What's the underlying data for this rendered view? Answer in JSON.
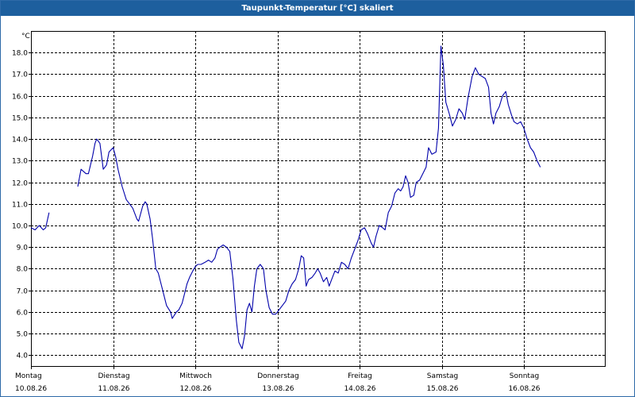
{
  "window": {
    "title": "Taupunkt-Temperatur [°C] skaliert"
  },
  "chart_data": {
    "type": "line",
    "title": "Taupunkt-Temperatur [°C] skaliert",
    "ylabel": "°C",
    "xlabel": "",
    "ylim": [
      3.5,
      19.0
    ],
    "yticks": [
      4.0,
      5.0,
      6.0,
      7.0,
      8.0,
      9.0,
      10.0,
      11.0,
      12.0,
      13.0,
      14.0,
      15.0,
      16.0,
      17.0,
      18.0
    ],
    "xlim": [
      0,
      7
    ],
    "xticks": [
      {
        "x": 0,
        "day": "Montag",
        "date": "10.08.26"
      },
      {
        "x": 1,
        "day": "Dienstag",
        "date": "11.08.26"
      },
      {
        "x": 2,
        "day": "Mittwoch",
        "date": "12.08.26"
      },
      {
        "x": 3,
        "day": "Donnerstag",
        "date": "13.08.26"
      },
      {
        "x": 4,
        "day": "Freitag",
        "date": "14.08.26"
      },
      {
        "x": 5,
        "day": "Samstag",
        "date": "15.08.26"
      },
      {
        "x": 6,
        "day": "Sonntag",
        "date": "16.08.26"
      }
    ],
    "grid": true,
    "line_color": "#0000aa",
    "series": [
      {
        "segments": [
          [
            [
              0.0,
              9.9
            ],
            [
              0.05,
              9.8
            ],
            [
              0.1,
              10.0
            ],
            [
              0.15,
              9.8
            ],
            [
              0.18,
              9.9
            ],
            [
              0.22,
              10.6
            ]
          ],
          [
            [
              0.57,
              11.8
            ],
            [
              0.61,
              12.6
            ],
            [
              0.67,
              12.4
            ],
            [
              0.7,
              12.4
            ],
            [
              0.75,
              13.2
            ],
            [
              0.78,
              13.8
            ],
            [
              0.8,
              14.0
            ],
            [
              0.84,
              13.8
            ],
            [
              0.88,
              12.6
            ],
            [
              0.92,
              12.8
            ],
            [
              0.95,
              13.4
            ],
            [
              1.0,
              13.6
            ],
            [
              1.03,
              13.2
            ],
            [
              1.06,
              12.6
            ],
            [
              1.11,
              11.8
            ],
            [
              1.16,
              11.2
            ],
            [
              1.2,
              11.0
            ],
            [
              1.24,
              10.8
            ],
            [
              1.29,
              10.3
            ],
            [
              1.31,
              10.2
            ],
            [
              1.36,
              10.9
            ],
            [
              1.39,
              11.1
            ],
            [
              1.41,
              11.0
            ],
            [
              1.45,
              10.3
            ],
            [
              1.48,
              9.4
            ],
            [
              1.52,
              8.0
            ],
            [
              1.55,
              7.8
            ],
            [
              1.59,
              7.2
            ],
            [
              1.65,
              6.3
            ],
            [
              1.7,
              6.0
            ],
            [
              1.72,
              5.7
            ],
            [
              1.77,
              6.0
            ],
            [
              1.8,
              6.1
            ],
            [
              1.84,
              6.4
            ],
            [
              1.86,
              6.7
            ],
            [
              1.9,
              7.3
            ],
            [
              1.93,
              7.6
            ],
            [
              1.97,
              7.9
            ],
            [
              2.0,
              8.1
            ],
            [
              2.03,
              8.2
            ],
            [
              2.07,
              8.2
            ],
            [
              2.12,
              8.3
            ],
            [
              2.16,
              8.4
            ],
            [
              2.2,
              8.3
            ],
            [
              2.24,
              8.5
            ],
            [
              2.27,
              8.9
            ],
            [
              2.3,
              9.0
            ],
            [
              2.34,
              9.1
            ],
            [
              2.38,
              9.0
            ],
            [
              2.42,
              8.8
            ],
            [
              2.46,
              7.5
            ],
            [
              2.5,
              5.6
            ],
            [
              2.53,
              4.6
            ],
            [
              2.57,
              4.3
            ],
            [
              2.6,
              4.9
            ],
            [
              2.63,
              6.1
            ],
            [
              2.66,
              6.4
            ],
            [
              2.69,
              6.0
            ],
            [
              2.72,
              7.2
            ],
            [
              2.75,
              8.0
            ],
            [
              2.79,
              8.2
            ],
            [
              2.83,
              8.0
            ],
            [
              2.86,
              7.0
            ],
            [
              2.9,
              6.2
            ],
            [
              2.94,
              5.9
            ],
            [
              2.98,
              5.9
            ],
            [
              3.02,
              6.1
            ],
            [
              3.06,
              6.3
            ],
            [
              3.1,
              6.5
            ],
            [
              3.14,
              7.0
            ],
            [
              3.18,
              7.3
            ],
            [
              3.22,
              7.5
            ],
            [
              3.26,
              8.0
            ],
            [
              3.29,
              8.6
            ],
            [
              3.32,
              8.5
            ],
            [
              3.35,
              7.2
            ],
            [
              3.38,
              7.5
            ],
            [
              3.42,
              7.6
            ],
            [
              3.46,
              7.8
            ],
            [
              3.49,
              8.0
            ],
            [
              3.52,
              7.8
            ],
            [
              3.56,
              7.4
            ],
            [
              3.6,
              7.6
            ],
            [
              3.63,
              7.2
            ],
            [
              3.66,
              7.5
            ],
            [
              3.7,
              7.9
            ],
            [
              3.74,
              7.8
            ],
            [
              3.78,
              8.3
            ],
            [
              3.82,
              8.2
            ],
            [
              3.86,
              8.0
            ],
            [
              3.9,
              8.5
            ],
            [
              3.94,
              8.9
            ],
            [
              3.98,
              9.3
            ],
            [
              4.02,
              9.8
            ],
            [
              4.06,
              9.9
            ],
            [
              4.1,
              9.6
            ],
            [
              4.14,
              9.2
            ],
            [
              4.17,
              9.0
            ],
            [
              4.2,
              9.5
            ],
            [
              4.24,
              10.0
            ],
            [
              4.28,
              9.9
            ],
            [
              4.31,
              9.8
            ],
            [
              4.35,
              10.6
            ],
            [
              4.39,
              10.9
            ],
            [
              4.43,
              11.5
            ],
            [
              4.47,
              11.7
            ],
            [
              4.5,
              11.6
            ],
            [
              4.53,
              11.8
            ],
            [
              4.56,
              12.3
            ],
            [
              4.59,
              12.0
            ],
            [
              4.62,
              11.3
            ],
            [
              4.66,
              11.4
            ],
            [
              4.69,
              12.0
            ],
            [
              4.73,
              12.1
            ],
            [
              4.77,
              12.4
            ],
            [
              4.81,
              12.7
            ],
            [
              4.84,
              13.6
            ],
            [
              4.88,
              13.3
            ],
            [
              4.93,
              13.4
            ],
            [
              4.96,
              14.5
            ],
            [
              4.99,
              18.3
            ],
            [
              5.02,
              17.4
            ],
            [
              5.05,
              15.7
            ],
            [
              5.09,
              15.2
            ],
            [
              5.13,
              14.6
            ],
            [
              5.17,
              14.9
            ],
            [
              5.21,
              15.4
            ],
            [
              5.25,
              15.2
            ],
            [
              5.28,
              14.9
            ],
            [
              5.32,
              15.9
            ],
            [
              5.37,
              16.9
            ],
            [
              5.41,
              17.3
            ],
            [
              5.45,
              17.0
            ],
            [
              5.49,
              16.9
            ],
            [
              5.53,
              16.8
            ],
            [
              5.57,
              16.4
            ],
            [
              5.6,
              15.2
            ],
            [
              5.63,
              14.7
            ],
            [
              5.66,
              15.2
            ],
            [
              5.7,
              15.5
            ],
            [
              5.74,
              16.0
            ],
            [
              5.78,
              16.2
            ],
            [
              5.81,
              15.6
            ],
            [
              5.85,
              15.1
            ],
            [
              5.88,
              14.8
            ],
            [
              5.92,
              14.7
            ],
            [
              5.96,
              14.8
            ],
            [
              6.0,
              14.5
            ],
            [
              6.04,
              14.0
            ],
            [
              6.08,
              13.6
            ],
            [
              6.12,
              13.4
            ],
            [
              6.16,
              13.0
            ],
            [
              6.2,
              12.7
            ]
          ]
        ]
      }
    ]
  }
}
